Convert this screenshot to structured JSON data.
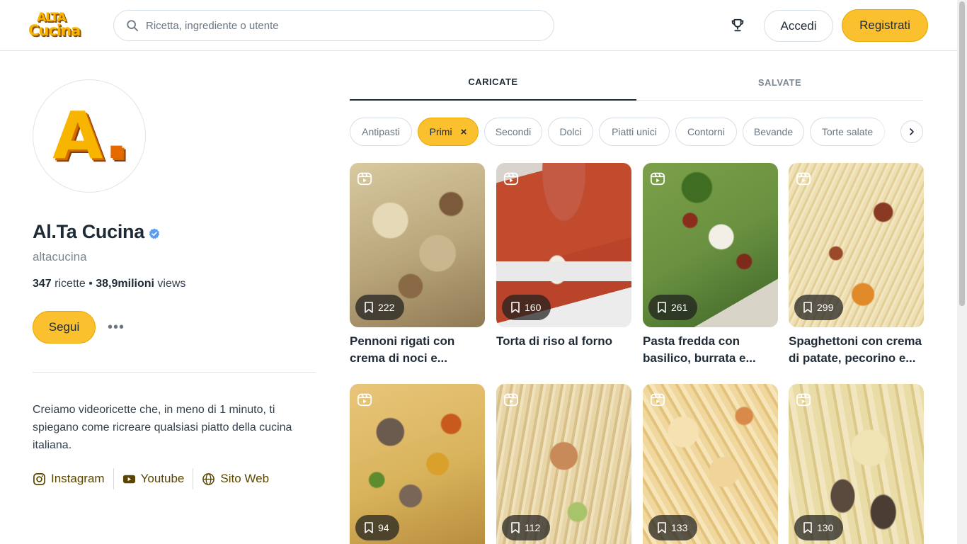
{
  "header": {
    "logo_line1": "ALTA",
    "logo_line2": "Cucina",
    "search_placeholder": "Ricetta, ingrediente o utente",
    "login_label": "Accedi",
    "register_label": "Registrati"
  },
  "profile": {
    "avatar_letter": "A",
    "avatar_dot": ".",
    "name": "Al.Ta Cucina",
    "handle": "altacucina",
    "recipes_count": "347",
    "recipes_label": "ricette",
    "separator": "•",
    "views_count": "38,9milioni",
    "views_label": "views",
    "follow_label": "Segui",
    "more_label": "•••",
    "bio": "Creiamo videoricette che, in meno di 1 minuto, ti spiegano come ricreare qualsiasi piatto della cucina italiana.",
    "links": [
      {
        "label": "Instagram",
        "icon": "instagram-icon"
      },
      {
        "label": "Youtube",
        "icon": "youtube-icon"
      },
      {
        "label": "Sito Web",
        "icon": "globe-icon"
      }
    ]
  },
  "tabs": [
    {
      "label": "CARICATE",
      "active": true
    },
    {
      "label": "SALVATE",
      "active": false
    }
  ],
  "chips": [
    {
      "label": "Antipasti",
      "selected": false
    },
    {
      "label": "Primi",
      "selected": true,
      "close": "×"
    },
    {
      "label": "Secondi",
      "selected": false
    },
    {
      "label": "Dolci",
      "selected": false
    },
    {
      "label": "Piatti unici",
      "selected": false
    },
    {
      "label": "Contorni",
      "selected": false
    },
    {
      "label": "Bevande",
      "selected": false
    },
    {
      "label": "Torte salate",
      "selected": false
    }
  ],
  "recipes": [
    {
      "title": "Pennoni rigati con crema di noci e...",
      "saves": "222"
    },
    {
      "title": "Torta di riso al forno",
      "saves": "160"
    },
    {
      "title": "Pasta fredda con basilico, burrata e...",
      "saves": "261"
    },
    {
      "title": "Spaghettoni con crema di patate, pecorino e...",
      "saves": "299"
    },
    {
      "title": "",
      "saves": "94"
    },
    {
      "title": "",
      "saves": "112"
    },
    {
      "title": "",
      "saves": "133"
    },
    {
      "title": "",
      "saves": "130"
    }
  ],
  "colors": {
    "accent": "#fbc02d",
    "text": "#1f2a37",
    "muted": "#7b8691",
    "verified": "#5b9cf0"
  }
}
